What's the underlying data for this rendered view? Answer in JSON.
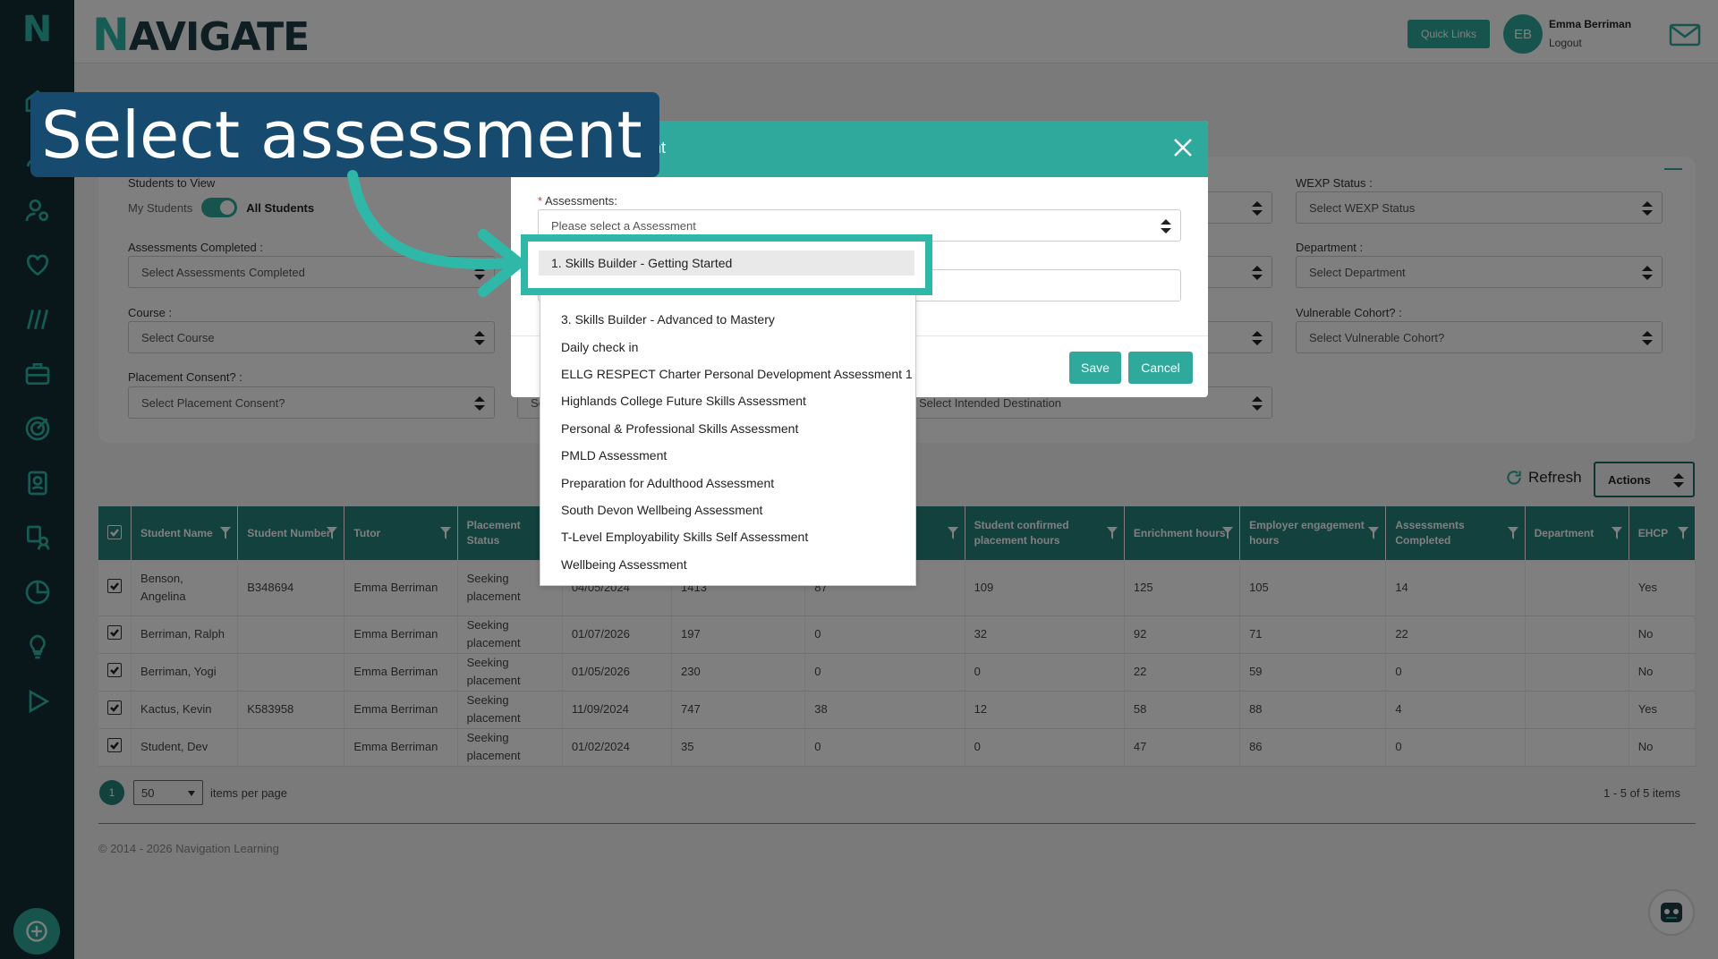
{
  "app": {
    "brand": "AVIGATE",
    "brand_initial": "N",
    "sidebar_logo": "N"
  },
  "header": {
    "quick_links": "Quick Links",
    "avatar_initials": "EB",
    "user_name": "Emma Berriman",
    "logout": "Logout"
  },
  "filters": {
    "students_to_view_label": "Students to View",
    "my_students": "My Students",
    "all_students": "All Students",
    "assessments_completed_label": "Assessments Completed :",
    "assessments_completed_placeholder": "Select Assessments Completed",
    "course_label": "Course :",
    "course_placeholder": "Select Course",
    "placement_consent_label": "Placement Consent? :",
    "placement_consent_placeholder": "Select Placement Consent?",
    "intended_destination_prefix": "Se",
    "intended_destination_placeholder": "Select Intended Destination",
    "wexp_status_label": "WEXP Status :",
    "wexp_status_placeholder": "Select WEXP Status",
    "department_label": "Department :",
    "department_placeholder": "Select Department",
    "vulnerable_cohort_label": "Vulnerable Cohort? :",
    "vulnerable_cohort_placeholder": "Select Vulnerable Cohort?"
  },
  "toolbar": {
    "refresh": "Refresh",
    "actions": "Actions"
  },
  "table": {
    "columns": [
      "Student Name",
      "Student Number",
      "Tutor",
      "Placement Status",
      "",
      "",
      "",
      "Student confirmed placement hours",
      "Enrichment hours",
      "Employer engagement hours",
      "Assessments Completed",
      "Department",
      "EHCP"
    ],
    "rows": [
      [
        "Benson, Angelina",
        "B348694",
        "Emma Berriman",
        "Seeking placement",
        "04/05/2024",
        "1413",
        "87",
        "109",
        "125",
        "105",
        "14",
        "",
        "Yes"
      ],
      [
        "Berriman, Ralph",
        "",
        "Emma Berriman",
        "Seeking placement",
        "01/07/2026",
        "197",
        "0",
        "32",
        "92",
        "71",
        "22",
        "",
        "No"
      ],
      [
        "Berriman, Yogi",
        "",
        "Emma Berriman",
        "Seeking placement",
        "01/05/2026",
        "230",
        "0",
        "0",
        "22",
        "59",
        "0",
        "",
        "No"
      ],
      [
        "Kactus, Kevin",
        "K583958",
        "Emma Berriman",
        "Seeking placement",
        "11/09/2024",
        "747",
        "38",
        "12",
        "58",
        "88",
        "4",
        "",
        "Yes"
      ],
      [
        "Student, Dev",
        "",
        "Emma Berriman",
        "Seeking placement",
        "01/02/2024",
        "35",
        "0",
        "0",
        "47",
        "86",
        "0",
        "",
        "No"
      ]
    ]
  },
  "pager": {
    "page": "1",
    "per_page": "50",
    "items_per_page": "items per page",
    "count": "1 - 5 of 5 items"
  },
  "footer": {
    "copyright": "© 2014 - 2026 Navigation Learning"
  },
  "modal": {
    "title_fragment": "nt",
    "required_mark": "*",
    "assessments_label": "Assessments:",
    "assessment_placeholder": "Please select a Assessment",
    "save": "Save",
    "cancel": "Cancel"
  },
  "dropdown": {
    "highlighted": "1. Skills Builder - Getting Started",
    "items": [
      "3. Skills Builder - Advanced to Mastery",
      "Daily check in",
      "ELLG RESPECT Charter Personal Development Assessment 1",
      "Highlands College Future Skills Assessment",
      "Personal & Professional Skills Assessment",
      "PMLD Assessment",
      "Preparation for Adulthood Assessment",
      "South Devon Wellbeing Assessment",
      "T-Level Employability Skills Self Assessment",
      "Wellbeing Assessment"
    ]
  },
  "callout": {
    "text": "Select assessment"
  },
  "colors": {
    "teal": "#2fa99b",
    "header_teal": "#27837b",
    "callout_blue": "#164a6e",
    "sidebar": "#142e34"
  }
}
